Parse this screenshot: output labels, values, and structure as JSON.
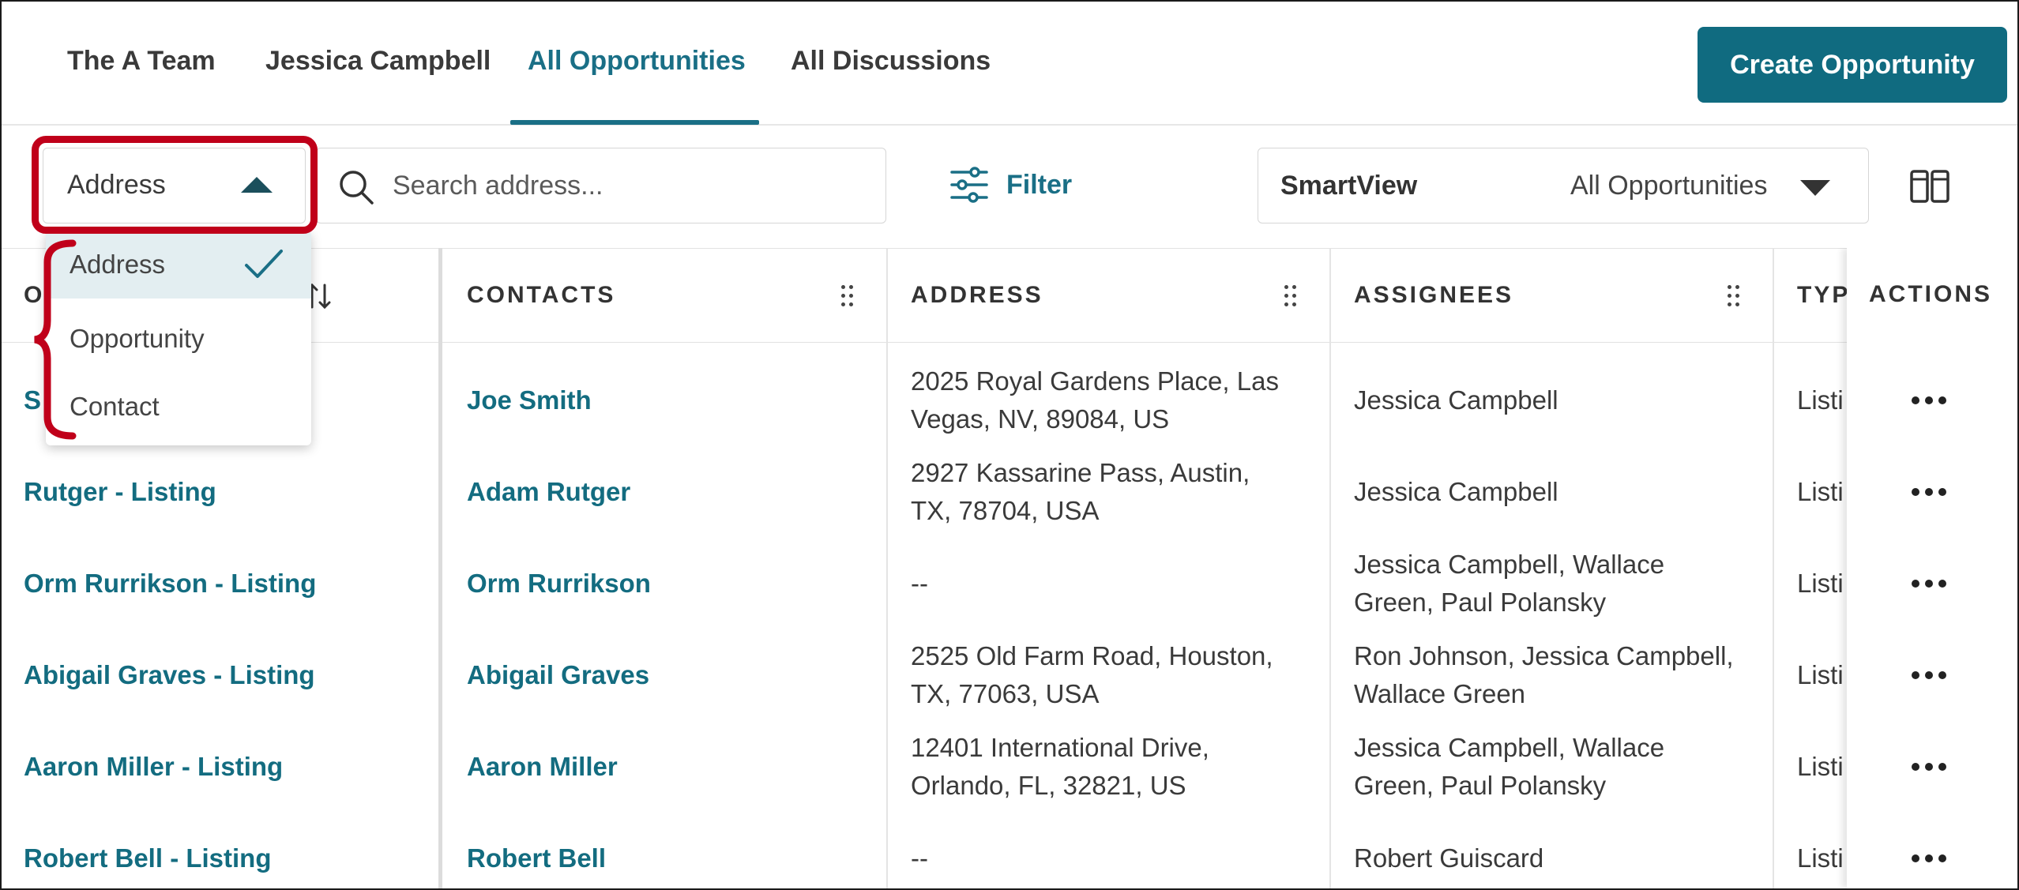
{
  "nav": {
    "tabs": [
      {
        "label": "The A Team"
      },
      {
        "label": "Jessica Campbell"
      },
      {
        "label": "All Opportunities",
        "active": true
      },
      {
        "label": "All Discussions"
      }
    ],
    "create_button": "Create Opportunity"
  },
  "toolbar": {
    "search_type": {
      "value": "Address",
      "options": [
        "Address",
        "Opportunity",
        "Contact"
      ],
      "selected": "Address"
    },
    "search_placeholder": "Search address...",
    "filter_label": "Filter",
    "smartview_label": "SmartView",
    "smartview_value": "All Opportunities"
  },
  "table": {
    "columns": {
      "opportunity_partial": "O",
      "contacts": "CONTACTS",
      "address": "ADDRESS",
      "assignees": "ASSIGNEES",
      "type_partial": "TYP",
      "actions": "ACTIONS"
    },
    "rows": [
      {
        "opportunity": "S",
        "contact": "Joe Smith",
        "address": "2025 Royal Gardens Place, Las\nVegas, NV, 89084, US",
        "assignees": "Jessica Campbell",
        "type": "Listi"
      },
      {
        "opportunity": "Rutger - Listing",
        "contact": "Adam Rutger",
        "address": "2927 Kassarine Pass, Austin,\nTX, 78704, USA",
        "assignees": "Jessica Campbell",
        "type": "Listi"
      },
      {
        "opportunity": "Orm Rurrikson - Listing",
        "contact": "Orm Rurrikson",
        "address": "--",
        "assignees": "Jessica Campbell, Wallace\nGreen, Paul Polansky",
        "type": "Listi"
      },
      {
        "opportunity": "Abigail Graves - Listing",
        "contact": "Abigail Graves",
        "address": "2525 Old Farm Road, Houston,\nTX, 77063, USA",
        "assignees": "Ron Johnson, Jessica Campbell,\nWallace Green",
        "type": "Listi"
      },
      {
        "opportunity": "Aaron Miller - Listing",
        "contact": "Aaron Miller",
        "address": "12401 International Drive,\nOrlando, FL, 32821, US",
        "assignees": "Jessica Campbell, Wallace\nGreen, Paul Polansky",
        "type": "Listi"
      },
      {
        "opportunity": "Robert Bell - Listing",
        "contact": "Robert Bell",
        "address": "--",
        "assignees": "Robert Guiscard",
        "type": "Listi"
      }
    ]
  },
  "colors": {
    "accent": "#106b80",
    "link": "#136c80",
    "highlight": "#c0001a",
    "selected_bg": "#e3eef1"
  }
}
